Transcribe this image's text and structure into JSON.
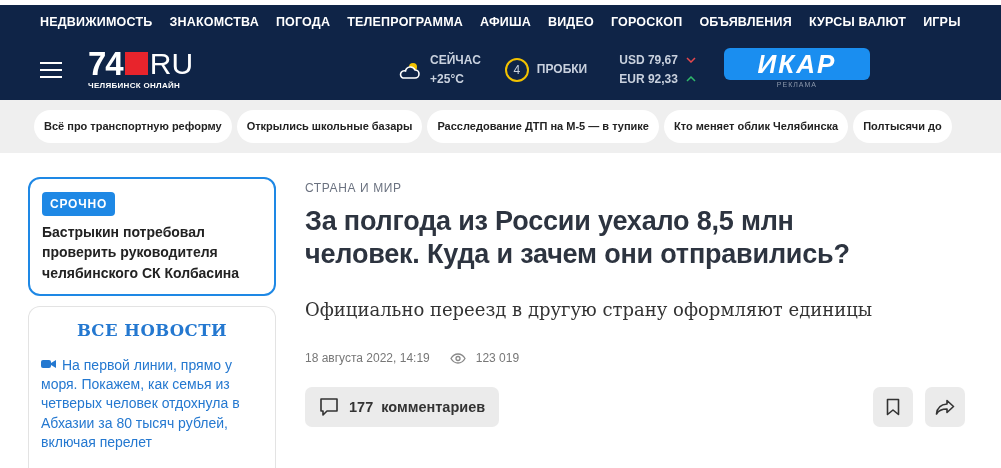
{
  "top_menu": [
    {
      "label": "НЕДВИЖИМОСТЬ"
    },
    {
      "label": "ЗНАКОМСТВА"
    },
    {
      "label": "ПОГОДА"
    },
    {
      "label": "ТЕЛЕПРОГРАММА"
    },
    {
      "label": "АФИША"
    },
    {
      "label": "ВИДЕО"
    },
    {
      "label": "ГОРОСКОП"
    },
    {
      "label": "ОБЪЯВЛЕНИЯ"
    },
    {
      "label": "КУРСЫ ВАЛЮТ"
    },
    {
      "label": "ИГРЫ"
    }
  ],
  "logo": {
    "number": "74",
    "domain": "RU",
    "subtitle": "ЧЕЛЯБИНСК ОНЛАЙН"
  },
  "weather": {
    "label": "СЕЙЧАС",
    "temperature": "+25°C"
  },
  "traffic": {
    "score": "4",
    "label": "ПРОБКИ"
  },
  "currencies": [
    {
      "text": "USD 79,67",
      "rising": false
    },
    {
      "text": "EUR 92,33",
      "rising": true
    }
  ],
  "ad": {
    "brand": "ИКАР",
    "caption": "РЕКЛАМА"
  },
  "topic_tags": [
    {
      "label": "Всё про транспортную реформу"
    },
    {
      "label": "Открылись школьные базары"
    },
    {
      "label": "Расследование ДТП на М-5 — в тупике"
    },
    {
      "label": "Кто меняет облик Челябинска"
    },
    {
      "label": "Полтысячи до"
    }
  ],
  "urgent": {
    "badge": "СРОЧНО",
    "text": "Бастрыкин потребовал проверить руководителя челябинского СК Колбасина"
  },
  "news_feed": {
    "title": "ВСЕ НОВОСТИ",
    "items": [
      {
        "kind": "video",
        "text": "На первой линии, прямо у моря. Покажем, как семья из четверых человек отдохнула в Абхазии за 80 тысяч рублей, включая перелет"
      }
    ]
  },
  "article": {
    "rubric": "СТРАНА И МИР",
    "title": "За полгода из России уехало 8,5 млн человек. Куда и зачем они отправились?",
    "lead": "Официально переезд в другую страну оформляют единицы",
    "date": "18 августа 2022, 14:19",
    "views": "123 019",
    "comments": {
      "count": "177",
      "label": "комментариев"
    }
  }
}
